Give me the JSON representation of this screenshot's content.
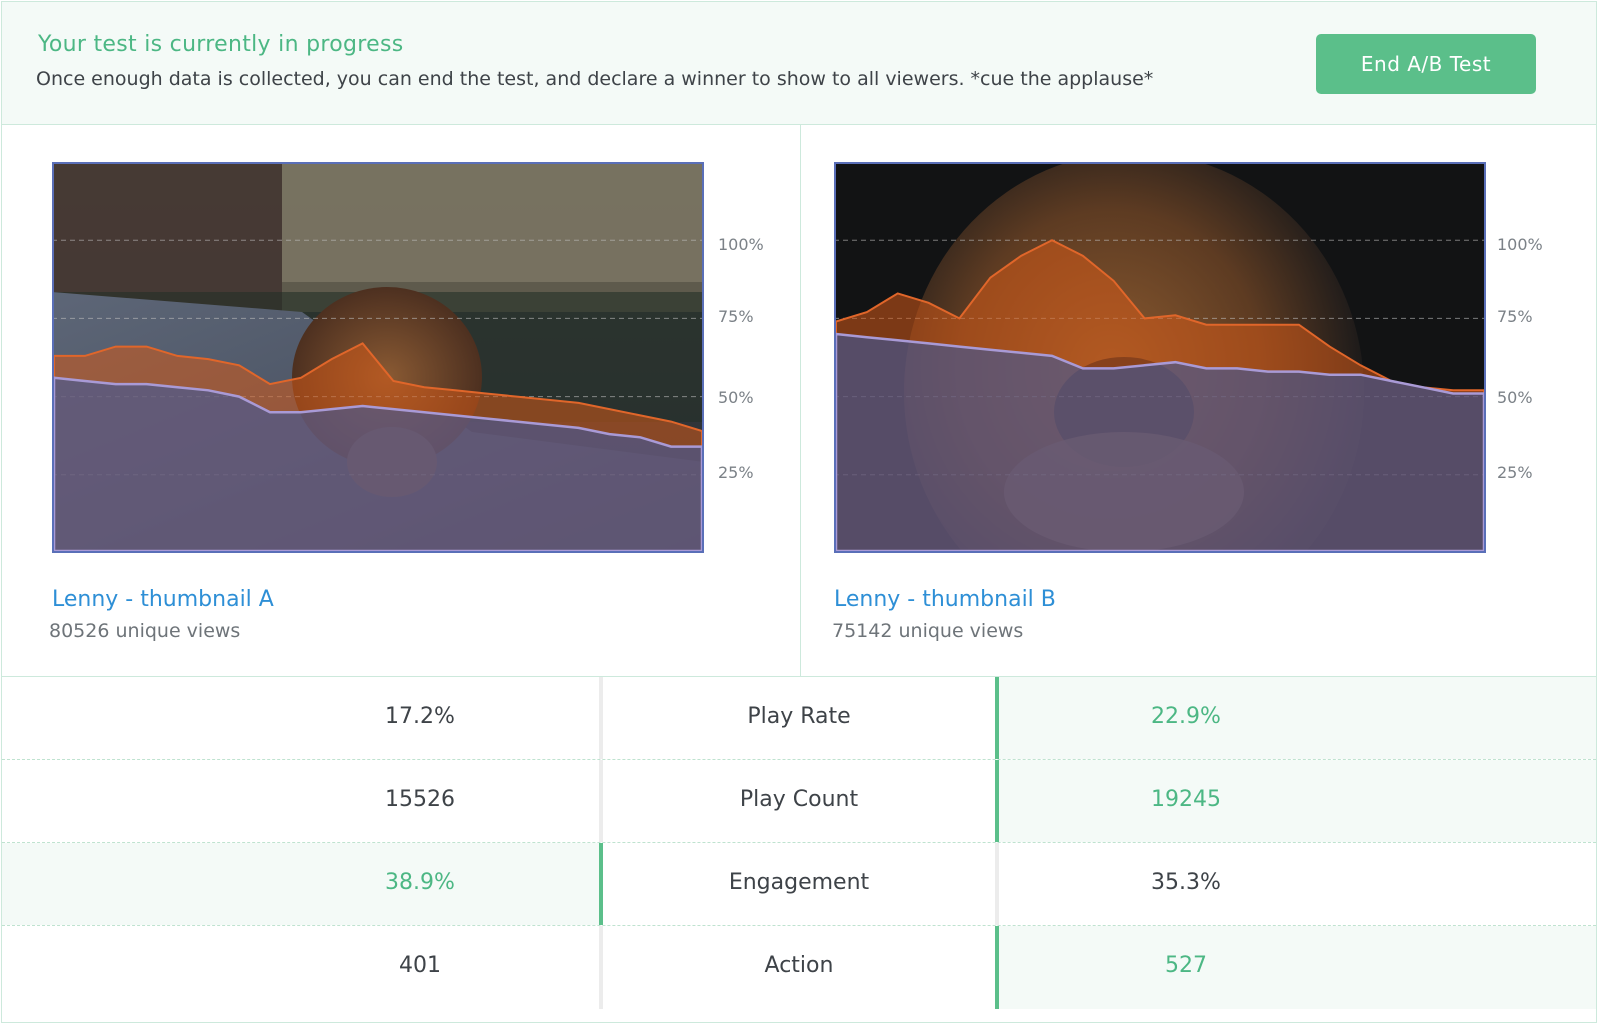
{
  "banner": {
    "title": "Your test is currently in progress",
    "text": "Once enough data is collected, you can end the test, and declare a winner to show to all viewers. *cue the applause*",
    "button_label": "End A/B Test"
  },
  "colors": {
    "accent": "#5bbf8a",
    "link": "#2e8fd6",
    "engagement_fill": "#d35a18",
    "retention_fill": "#3e5a9e"
  },
  "thumbnails": [
    {
      "name": "Lenny - thumbnail A",
      "views": "80526 unique views",
      "axis_labels": [
        "100%",
        "75%",
        "50%",
        "25%"
      ]
    },
    {
      "name": "Lenny - thumbnail B",
      "views": "75142 unique views",
      "axis_labels": [
        "100%",
        "75%",
        "50%",
        "25%"
      ]
    }
  ],
  "chart_data": [
    {
      "type": "area",
      "title": "",
      "ylim": [
        0,
        125
      ],
      "yticks": [
        "100%",
        "75%",
        "50%",
        "25%"
      ],
      "series": [
        {
          "values": [
            63,
            63,
            66,
            66,
            63,
            62,
            60,
            54,
            56,
            62,
            67,
            55,
            53,
            52,
            51,
            50,
            49,
            48,
            46,
            44,
            42,
            39
          ]
        },
        {
          "values": [
            56,
            55,
            54,
            54,
            53,
            52,
            50,
            45,
            45,
            46,
            47,
            46,
            45,
            44,
            43,
            42,
            41,
            40,
            38,
            37,
            34,
            34
          ]
        }
      ]
    },
    {
      "type": "area",
      "title": "",
      "ylim": [
        0,
        125
      ],
      "yticks": [
        "100%",
        "75%",
        "50%",
        "25%"
      ],
      "series": [
        {
          "values": [
            74,
            77,
            83,
            80,
            75,
            88,
            95,
            100,
            95,
            87,
            75,
            76,
            73,
            73,
            73,
            73,
            66,
            60,
            55,
            53,
            52,
            52
          ]
        },
        {
          "values": [
            70,
            69,
            68,
            67,
            66,
            65,
            64,
            63,
            59,
            59,
            60,
            61,
            59,
            59,
            58,
            58,
            57,
            57,
            55,
            53,
            51,
            51
          ]
        }
      ]
    }
  ],
  "stats": [
    {
      "a": "17.2%",
      "metric": "Play Rate",
      "b": "22.9%"
    },
    {
      "a": "15526",
      "metric": "Play Count",
      "b": "19245"
    },
    {
      "a": "38.9%",
      "metric": "Engagement",
      "b": "35.3%"
    },
    {
      "a": "401",
      "metric": "Action",
      "b": "527"
    }
  ],
  "winners": [
    "b",
    "b",
    "a",
    "b"
  ]
}
